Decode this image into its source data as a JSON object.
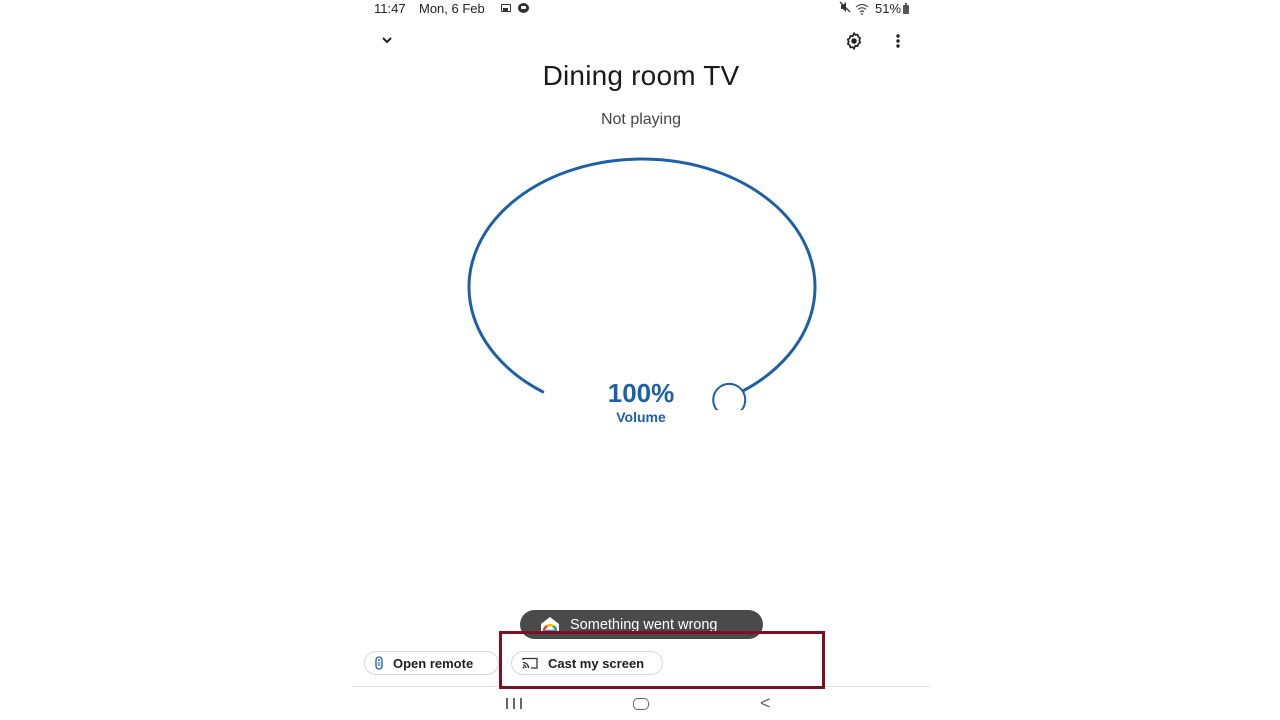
{
  "status_bar": {
    "time": "11:47",
    "date": "Mon, 6 Feb",
    "icons_left": [
      "gallery-icon",
      "app-notification-icon"
    ],
    "icons_right": [
      "mute-icon",
      "wifi-icon",
      "battery-icon"
    ],
    "battery": "51%"
  },
  "header": {
    "collapse_icon": "chevron-down-icon",
    "settings_icon": "gear-icon",
    "more_icon": "more-vert-icon"
  },
  "device": {
    "name": "Dining room TV",
    "status": "Not playing"
  },
  "volume": {
    "value_text": "100%",
    "label": "Volume",
    "level": 1.0,
    "accent_color": "#1e5fa8"
  },
  "toast": {
    "icon": "google-home-icon",
    "message": "Something went wrong"
  },
  "actions": [
    {
      "label": "Open remote",
      "icon": "remote-icon"
    },
    {
      "label": "Cast my screen",
      "icon": "cast-icon"
    }
  ],
  "nav_bar": {
    "recents_icon": "recents-icon",
    "home_icon": "home-icon",
    "back_icon": "back-icon",
    "back_glyph": "<"
  },
  "annotation": {
    "highlight_color": "#7b1222"
  }
}
